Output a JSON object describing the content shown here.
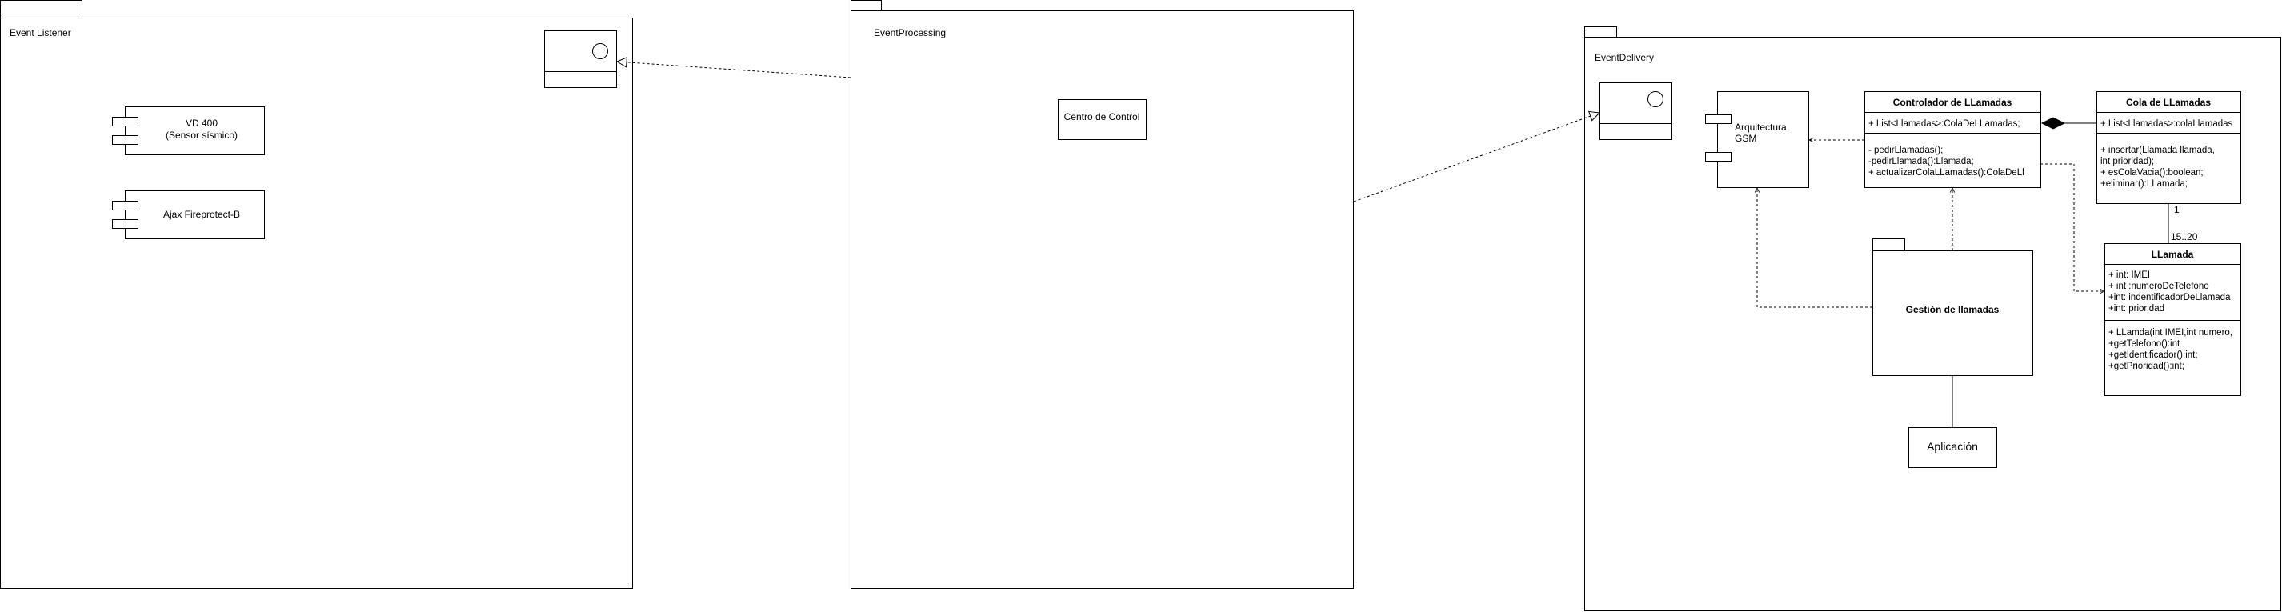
{
  "packages": {
    "event_listener": {
      "name": "Event Listener"
    },
    "event_processing": {
      "name": "EventProcessing"
    },
    "event_delivery": {
      "name": "EventDelivery"
    },
    "gestion": {
      "name": "Gestión de llamadas"
    }
  },
  "components": {
    "vd400": {
      "line1": "VD 400",
      "line2": "(Sensor sísmico)"
    },
    "ajax": {
      "name": "Ajax Fireprotect-B"
    },
    "centro": {
      "name": "Centro de Control"
    },
    "arquitectura": {
      "line1": "Arquitectura",
      "line2": "GSM"
    },
    "aplicacion": {
      "name": "Aplicación"
    }
  },
  "classes": {
    "controlador": {
      "name": "Controlador de LLamadas",
      "attributes": [
        "+ List<Llamadas>:ColaDeLLamadas;"
      ],
      "methods": [
        "- pedirLlamadas();",
        "-pedirLlamada():Llamada;",
        "+ actualizarColaLLamadas():ColaDeLl"
      ]
    },
    "cola": {
      "name": "Cola de LLamadas",
      "attributes": [
        "+ List<Llamadas>:colaLlamadas"
      ],
      "methods": [
        "+ insertar(Llamada llamada,",
        "int prioridad);",
        "+ esColaVacia():boolean;",
        "+eliminar():LLamada;"
      ]
    },
    "llamada": {
      "name": "LLamada",
      "attributes": [
        "+ int: IMEI",
        "+ int :numeroDeTelefono",
        "+int: indentificadorDeLlamada",
        "+int: prioridad"
      ],
      "methods": [
        "+ LLamda(int IMEI,int numero,",
        "+getTelefono():int",
        "+getIdentificador():int;",
        "+getPrioridad():int;"
      ]
    }
  },
  "multiplicity": {
    "cola_end": "1",
    "llamada_end": "15..20"
  }
}
